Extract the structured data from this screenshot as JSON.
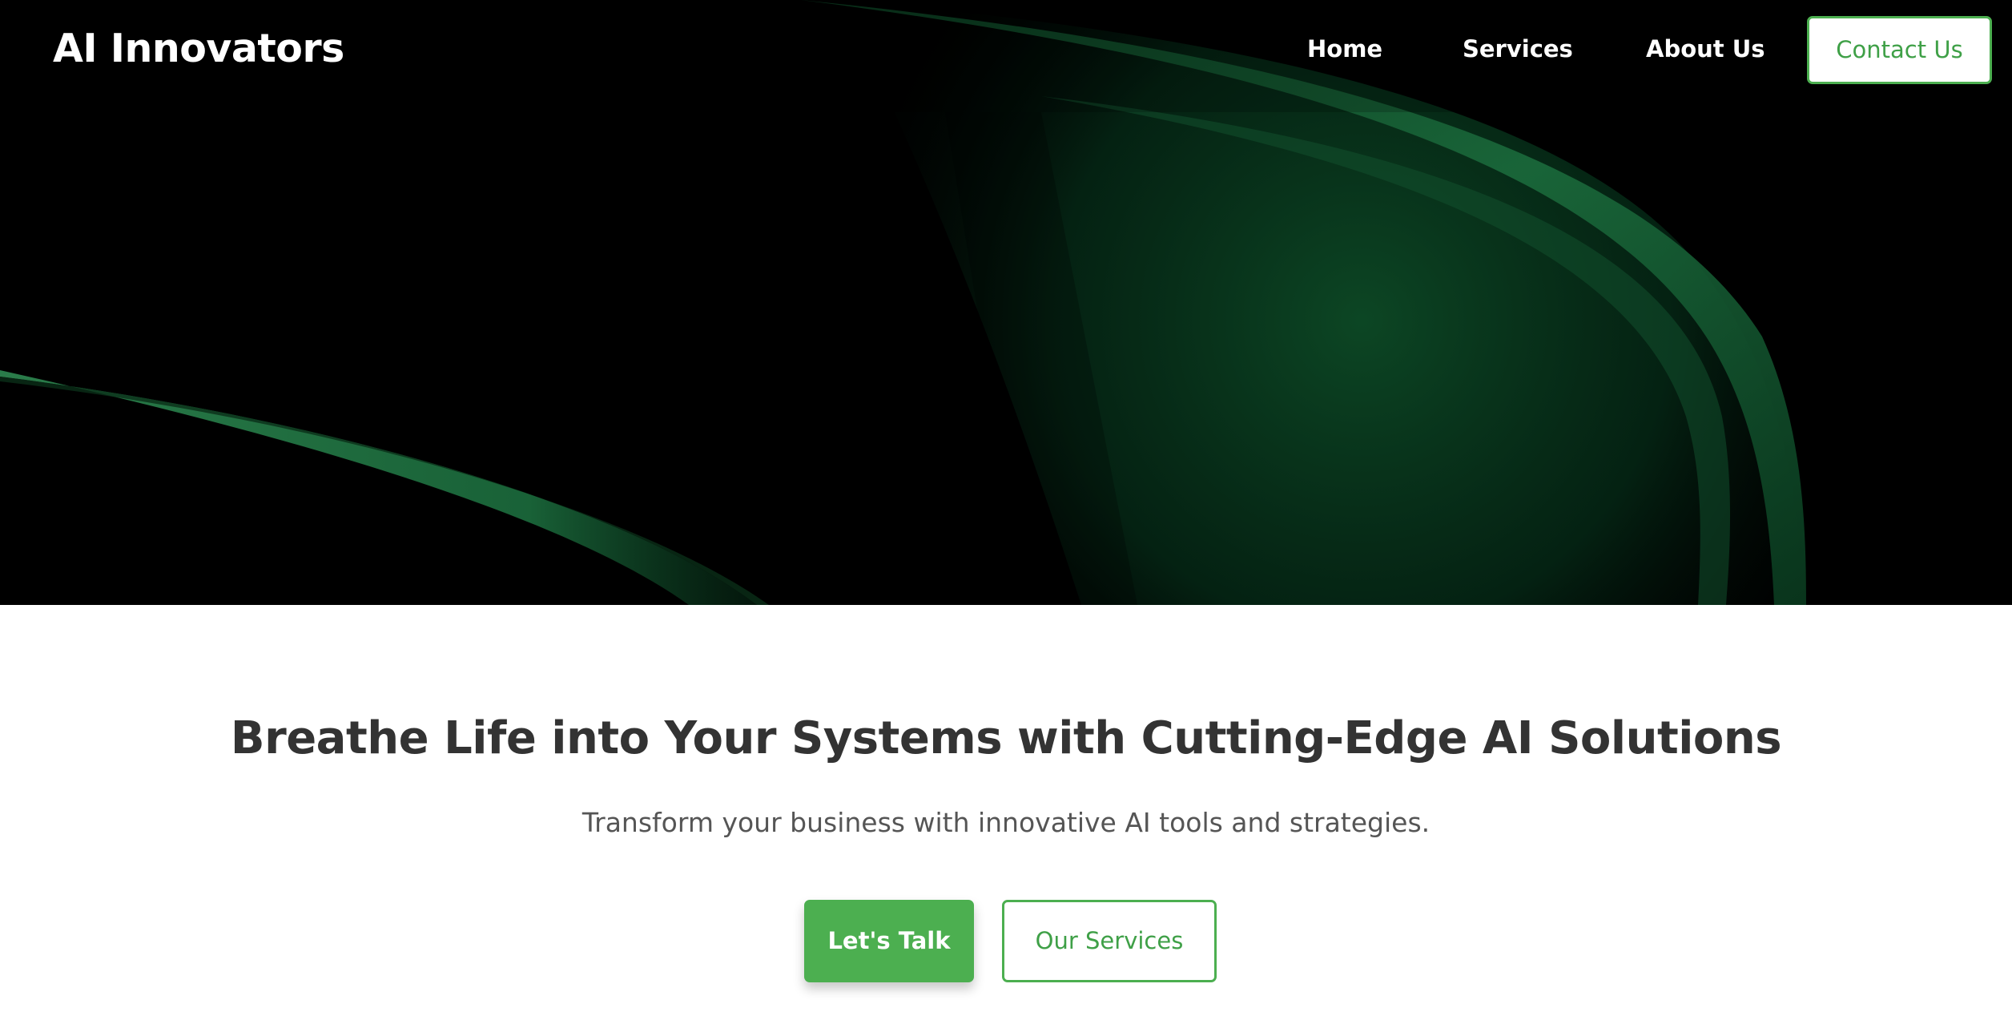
{
  "colors": {
    "accent": "#4caf50",
    "accent_text": "#3fa047",
    "hero_background": "#000000",
    "heading_text": "#333333",
    "body_text": "#555555"
  },
  "header": {
    "brand": "AI Innovators",
    "nav": {
      "home": "Home",
      "services": "Services",
      "about": "About Us"
    },
    "contact_label": "Contact Us"
  },
  "main": {
    "headline": "Breathe Life into Your Systems with Cutting-Edge AI Solutions",
    "subheadline": "Transform your business with innovative AI tools and strategies.",
    "primary_cta": "Let's Talk",
    "secondary_cta": "Our Services"
  }
}
